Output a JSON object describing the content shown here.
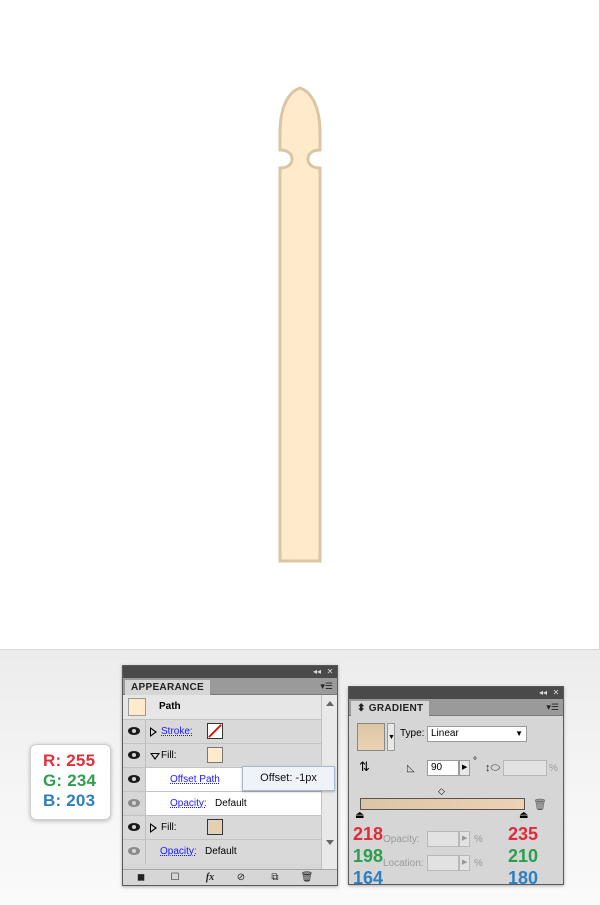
{
  "colors": {
    "fill_color": "#ffeacb",
    "fill_stroke": "#dac6a4",
    "gradient_start": "#dac6a4",
    "gradient_end": "#ebd2b4",
    "red_text": "#e02a3a",
    "green_text": "#2a9e4c",
    "blue_text": "#2c7fc2"
  },
  "rgb_note": {
    "r": "R: 255",
    "g": "G: 234",
    "b": "B: 203"
  },
  "appearance_panel": {
    "tab": "APPEARANCE",
    "header_title": "Path",
    "rows": {
      "stroke_label": "Stroke:",
      "fill_label": "Fill:",
      "offset_path_label": "Offset Path",
      "opacity_label": "Opacity:",
      "opacity_value": "Default",
      "fill2_label": "Fill:",
      "opacity2_label": "Opacity:",
      "opacity2_value": "Default"
    },
    "footer_icons": [
      "new-layer-icon",
      "clear-icon",
      "fx-icon",
      "no-icon",
      "duplicate-icon",
      "trash-icon"
    ],
    "fx_glyph": "fx"
  },
  "offset_tooltip": "Offset: -1px",
  "gradient_panel": {
    "tab": "GRADIENT",
    "type_label": "Type:",
    "type_value": "Linear",
    "angle_value": "90",
    "degree_symbol": "°",
    "percent_symbol": "%",
    "opacity_label": "Opacity:",
    "location_label": "Location:",
    "left_stop": {
      "r": "218",
      "g": "198",
      "b": "164"
    },
    "right_stop": {
      "r": "235",
      "g": "210",
      "b": "180"
    }
  }
}
